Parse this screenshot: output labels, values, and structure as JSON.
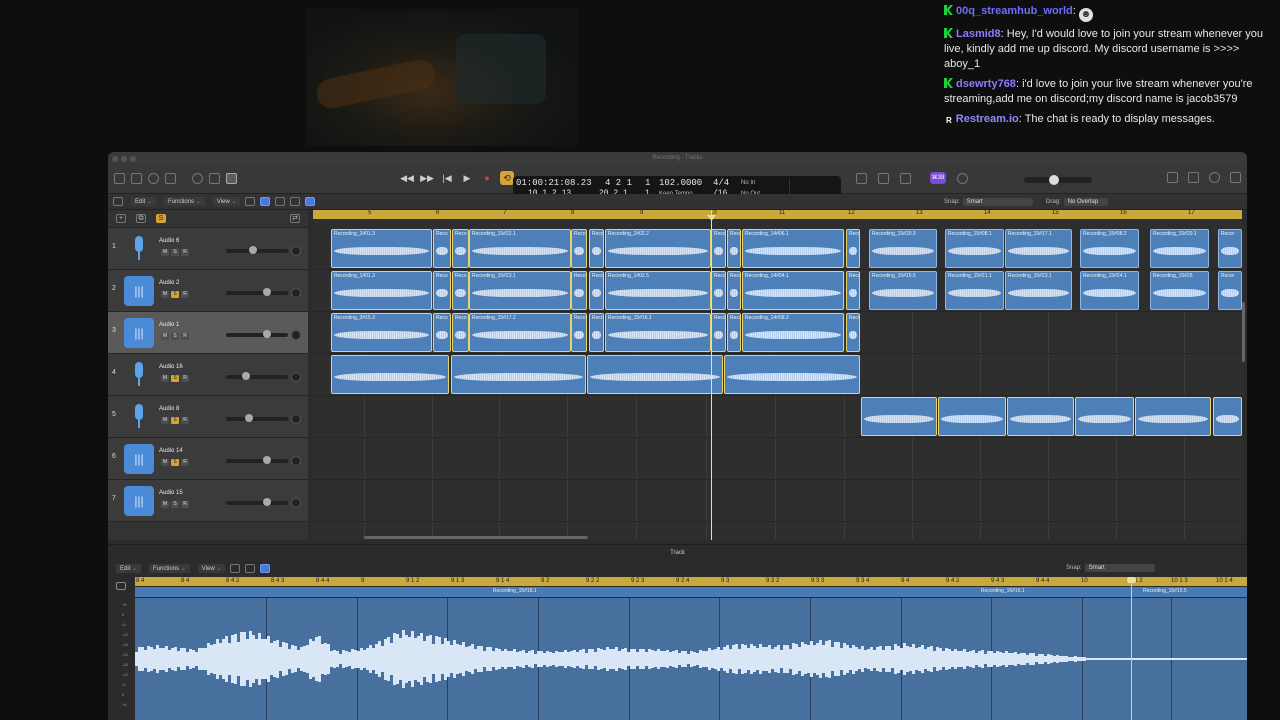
{
  "window": {
    "title": "Recording - Tracks"
  },
  "chat": {
    "messages": [
      {
        "user": "00q_streamhub_world",
        "sep": ":",
        "text": "",
        "badge": "kick"
      },
      {
        "user": "Lasmid8",
        "sep": ":",
        "text": "Hey, I'd would love to join your stream whenever you live, kindly add me up discord. My discord username is >>>> aboy_1",
        "badge": "kick"
      },
      {
        "user": "dsewrty768",
        "sep": ":",
        "text": "i'd love to join your live stream whenever you're streaming,add me on discord;my discord name is jacob3579",
        "badge": "kick"
      },
      {
        "user": "Restream.io",
        "sep": ":",
        "text": "The chat is ready to display messages.",
        "badge": "restream"
      }
    ]
  },
  "lcd": {
    "time": "01:00:21:08.23",
    "bars": "10  1  2    13",
    "pos1": "4  2  1",
    "pos1b": "1",
    "pos2": "20  2  1",
    "pos2b": "1",
    "tempo": "102.0000",
    "tempo_label": "Keep Tempo",
    "sig": "4/4",
    "sig_sub": "/16",
    "in": "No In",
    "out": "No Out"
  },
  "toolbar": {
    "badge_label": "⌘38"
  },
  "menubar": {
    "edit": "Edit",
    "functions": "Functions",
    "view": "View",
    "snap_label": "Snap:",
    "snap_value": "Smart",
    "drag_label": "Drag:",
    "drag_value": "No Overlap"
  },
  "ruler": {
    "bars": [
      "5",
      "6",
      "7",
      "8",
      "9",
      "10",
      "11",
      "12",
      "13",
      "14",
      "15",
      "16",
      "17"
    ]
  },
  "tracks": [
    {
      "num": "1",
      "name": "Audio 6",
      "icon": "mic-icon",
      "solo": false,
      "fader": 0.42
    },
    {
      "num": "2",
      "name": "Audio 2",
      "icon": "waveform-icon",
      "solo": true,
      "fader": 0.68
    },
    {
      "num": "3",
      "name": "Audio 1",
      "icon": "waveform-icon",
      "solo": false,
      "fader": 0.68,
      "selected": true
    },
    {
      "num": "4",
      "name": "Audio 16",
      "icon": "mic-icon",
      "solo": true,
      "fader": 0.3
    },
    {
      "num": "5",
      "name": "Audio 8",
      "icon": "mic-icon",
      "solo": true,
      "fader": 0.36
    },
    {
      "num": "6",
      "name": "Audio 14",
      "icon": "waveform-icon",
      "solo": true,
      "fader": 0.68
    },
    {
      "num": "7",
      "name": "Audio 15",
      "icon": "waveform-icon",
      "solo": false,
      "fader": 0.68
    }
  ],
  "regions": [
    [
      "Recording_2#01.3",
      "Reco",
      "Reco",
      "Recording_15#22.1",
      "Reco",
      "Reco",
      "Recording_2#02.2",
      "Reco",
      "Reco",
      "Recording_14#06.1",
      "Reco",
      "Recording_15#20.3",
      "Recording_15#08.1",
      "Recording_15#17.1",
      "Recording_15#08.2",
      "Recording_15#29.1",
      "Recor"
    ],
    [
      "Recording_1#01.3",
      "Reco",
      "Reco",
      "Recording_15#23.1",
      "Reco",
      "Reco",
      "Recording_1#02.5",
      "Reco",
      "Reco",
      "Recording_14#04.1",
      "Reco",
      "Recording_15#15.5",
      "Recording_15#21.1",
      "Recording_15#23.1",
      "Recording_15#24.1",
      "Recording_15#25",
      "Recor"
    ],
    [
      "Recording_3#15.3",
      "Reco",
      "Reco",
      "Recording_15#17.2",
      "Reco",
      "Recor",
      "Recording_15#16.1",
      "Reco",
      "Reco",
      "Recording_14#08.3",
      "Reco"
    ]
  ],
  "editor": {
    "title": "Track",
    "edit": "Edit",
    "functions": "Functions",
    "view": "View",
    "snap_label": "Snap:",
    "snap_value": "Smart",
    "ruler": [
      "8 4",
      "8 4",
      "8 4 2",
      "8 4 3",
      "8 4 4",
      "9",
      "9 1 2",
      "9 1 3",
      "9 1 4",
      "9 2",
      "9 2 2",
      "9 2 3",
      "9 2 4",
      "9 3",
      "9 3 2",
      "9 3 3",
      "9 3 4",
      "9 4",
      "9 4 2",
      "9 4 3",
      "9 4 4",
      "10",
      "10 1 2",
      "10 1 3",
      "10 1 4"
    ],
    "regions": [
      "Recording_15#18.1",
      "Recording_16#16.1",
      "Recording_15#15.5"
    ],
    "db": [
      "+6",
      "0",
      "-6",
      "-12",
      "-18",
      "-24",
      "-18",
      "-12",
      "-6",
      "0",
      "+6"
    ]
  }
}
